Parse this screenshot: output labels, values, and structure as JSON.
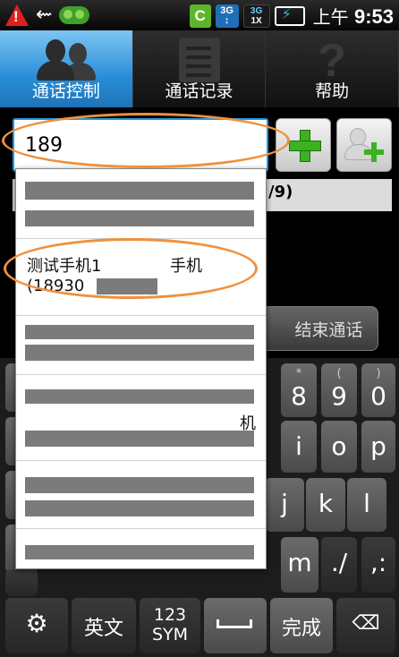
{
  "status_bar": {
    "icons": [
      "warning-icon",
      "usb-icon",
      "pea-icon"
    ],
    "warning_glyph": "!",
    "app_badge": "C",
    "net_top": "3G",
    "net_bottom": "1X",
    "time_prefix": "上午",
    "time": "9:53"
  },
  "tabs": [
    {
      "label": "通话控制",
      "icon": "people-icon",
      "active": true
    },
    {
      "label": "通话记录",
      "icon": "notepad-icon",
      "active": false
    },
    {
      "label": "帮助",
      "icon": "question-icon",
      "active": false
    }
  ],
  "search": {
    "value": "189"
  },
  "buttons": {
    "add": "plus-icon",
    "add_contact": "add-person-icon",
    "end_call": "结束通话"
  },
  "count_text": "/9)",
  "suggestions": [
    {
      "name": "",
      "type": "",
      "number": "",
      "redacted": true
    },
    {
      "name": "测试手机1",
      "type": "手机",
      "number": "(18930",
      "redacted": false
    },
    {
      "name": "",
      "type": "",
      "number": "",
      "redacted": true
    },
    {
      "name": "",
      "type": "机",
      "number": "",
      "redacted": true
    },
    {
      "name": "",
      "type": "",
      "number": "",
      "redacted": true
    },
    {
      "name": "",
      "type": "",
      "number": "",
      "redacted": true
    }
  ],
  "keyboard": {
    "row2": [
      {
        "sup": "*",
        "key": "8"
      },
      {
        "sup": "(",
        "key": "9"
      },
      {
        "sup": ")",
        "key": "0"
      }
    ],
    "row3": [
      "i",
      "o",
      "p"
    ],
    "row4": [
      "j",
      "k",
      "l"
    ],
    "row5": [
      "m",
      "./",
      ",:"
    ],
    "bottom": {
      "settings": "gear-icon",
      "lang": "英文",
      "sym_top": "123",
      "sym_bottom": "SYM",
      "space": "space-icon",
      "done": "完成",
      "delete": "backspace-icon"
    }
  },
  "colors": {
    "tab_active": "#2a8ed6",
    "highlight": "#f0903c",
    "accent_green": "#3bb21f"
  }
}
